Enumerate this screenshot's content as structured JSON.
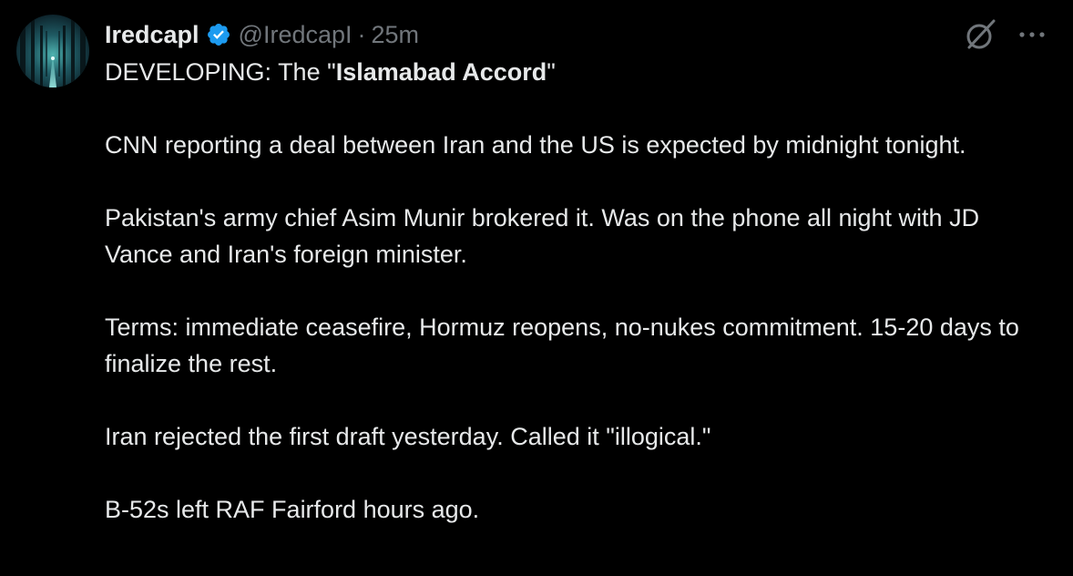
{
  "author": {
    "display_name": "Iredcapl",
    "handle": "@IredcapI",
    "separator": "·",
    "time_ago": "25m",
    "verified": true
  },
  "icons": {
    "verified": "verified-badge-icon",
    "grok": "grok-icon",
    "more": "more-options-icon"
  },
  "colors": {
    "background": "#000000",
    "text": "#e7e9ea",
    "secondary": "#71767b",
    "verified_blue": "#1d9bf0"
  },
  "tweet": {
    "line1_prefix": "DEVELOPING: The \"",
    "line1_bold": "Islamabad Accord",
    "line1_suffix": "\"",
    "p2": "CNN reporting a deal between Iran and the US is expected by midnight tonight.",
    "p3": "Pakistan's army chief Asim Munir brokered it. Was on the phone all night with JD Vance and Iran's foreign minister.",
    "p4": "Terms: immediate ceasefire, Hormuz reopens, no-nukes commitment. 15-20 days to finalize the rest.",
    "p5": "Iran rejected the first draft yesterday. Called it \"illogical.\"",
    "p6": "B-52s left RAF Fairford hours ago."
  }
}
